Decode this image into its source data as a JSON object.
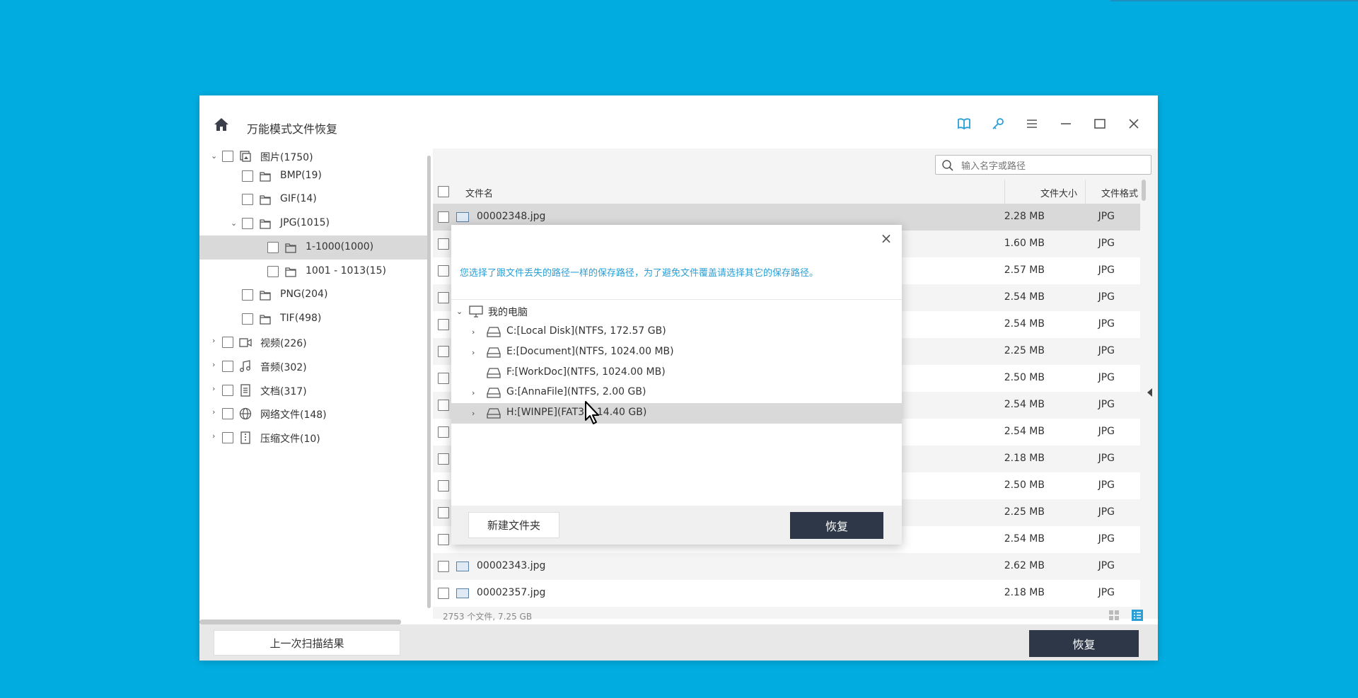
{
  "app": {
    "title": "万能模式文件恢复"
  },
  "toolbar": {
    "icons": [
      "book-icon",
      "key-icon",
      "menu-icon",
      "minimize-icon",
      "maximize-icon",
      "close-icon"
    ]
  },
  "tree": {
    "items": [
      {
        "label": "图片(1750)",
        "expanded": true
      },
      {
        "label": "BMP(19)"
      },
      {
        "label": "GIF(14)"
      },
      {
        "label": "JPG(1015)",
        "expanded": true
      },
      {
        "label": "1-1000(1000)",
        "selected": true
      },
      {
        "label": "1001 -  1013(15)"
      },
      {
        "label": "PNG(204)"
      },
      {
        "label": "TIF(498)"
      },
      {
        "label": "视频(226)"
      },
      {
        "label": "音频(302)"
      },
      {
        "label": "文档(317)"
      },
      {
        "label": "网络文件(148)"
      },
      {
        "label": "压缩文件(10)"
      }
    ]
  },
  "search": {
    "placeholder": "输入名字或路径"
  },
  "table": {
    "headers": {
      "name": "文件名",
      "size": "文件大小",
      "type": "文件格式"
    },
    "rows": [
      {
        "name": "00002348.jpg",
        "size": "2.28 MB",
        "type": "JPG"
      },
      {
        "name": "",
        "size": "1.60 MB",
        "type": "JPG"
      },
      {
        "name": "",
        "size": "2.57 MB",
        "type": "JPG"
      },
      {
        "name": "",
        "size": "2.54 MB",
        "type": "JPG"
      },
      {
        "name": "",
        "size": "2.54 MB",
        "type": "JPG"
      },
      {
        "name": "",
        "size": "2.25 MB",
        "type": "JPG"
      },
      {
        "name": "",
        "size": "2.50 MB",
        "type": "JPG"
      },
      {
        "name": "",
        "size": "2.54 MB",
        "type": "JPG"
      },
      {
        "name": "",
        "size": "2.54 MB",
        "type": "JPG"
      },
      {
        "name": "",
        "size": "2.18 MB",
        "type": "JPG"
      },
      {
        "name": "",
        "size": "2.50 MB",
        "type": "JPG"
      },
      {
        "name": "",
        "size": "2.25 MB",
        "type": "JPG"
      },
      {
        "name": "",
        "size": "2.54 MB",
        "type": "JPG"
      },
      {
        "name": "00002343.jpg",
        "size": "2.62 MB",
        "type": "JPG"
      },
      {
        "name": "00002357.jpg",
        "size": "2.18 MB",
        "type": "JPG"
      }
    ]
  },
  "status": {
    "summary": "2753 个文件, 7.25 GB"
  },
  "footer": {
    "prev_scan": "上一次扫描结果",
    "recover": "恢复"
  },
  "dialog": {
    "message": "您选择了跟文件丢失的路径一样的保存路径，为了避免文件覆盖请选择其它的保存路径。",
    "root": "我的电脑",
    "drives": [
      {
        "label": "C:[Local Disk](NTFS, 172.57 GB)",
        "expandable": true
      },
      {
        "label": "E:[Document](NTFS, 1024.00 MB)",
        "expandable": true
      },
      {
        "label": "F:[WorkDoc](NTFS, 1024.00 MB)",
        "expandable": false
      },
      {
        "label": "G:[AnnaFile](NTFS, 2.00 GB)",
        "expandable": true
      },
      {
        "label": "H:[WINPE](FAT32, 14.40 GB)",
        "expandable": true,
        "selected": true
      }
    ],
    "new_folder": "新建文件夹",
    "recover": "恢复"
  },
  "colors": {
    "background": "#01ADE0",
    "dark_button": "#2D3748",
    "message_blue": "#2A9FD6",
    "selection": "#D9D9D9"
  }
}
